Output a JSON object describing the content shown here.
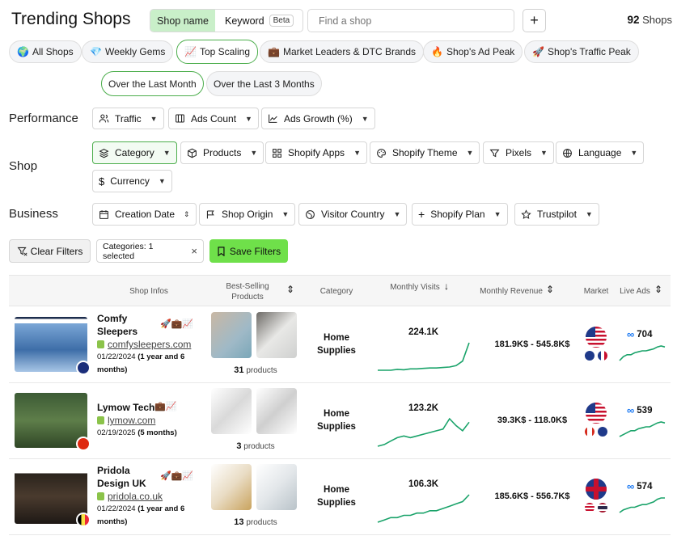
{
  "header": {
    "title": "Trending Shops",
    "tab_shop_name": "Shop name",
    "tab_keyword": "Keyword",
    "beta": "Beta",
    "search_placeholder": "Find a shop",
    "add": "+",
    "count_num": "92",
    "count_label": "Shops"
  },
  "quick_filters": [
    {
      "icon": "🌍",
      "label": "All Shops"
    },
    {
      "icon": "💎",
      "label": "Weekly Gems"
    },
    {
      "icon": "📈",
      "label": "Top Scaling"
    },
    {
      "icon": "💼",
      "label": "Market Leaders & DTC Brands"
    },
    {
      "icon": "🔥",
      "label": "Shop's Ad Peak"
    },
    {
      "icon": "🚀",
      "label": "Shop's Traffic Peak"
    }
  ],
  "periods": [
    "Over the Last Month",
    "Over the Last 3 Months"
  ],
  "sections": {
    "performance": "Performance",
    "shop": "Shop",
    "business": "Business"
  },
  "perf_filters": [
    "Traffic",
    "Ads Count",
    "Ads Growth (%)"
  ],
  "shop_filters": [
    "Category",
    "Products",
    "Shopify Apps",
    "Shopify Theme",
    "Pixels",
    "Language",
    "Currency"
  ],
  "business_filters": [
    "Creation Date",
    "Shop Origin",
    "Visitor Country",
    "Shopify Plan",
    "Trustpilot"
  ],
  "actions": {
    "clear": "Clear Filters",
    "tag": "Categories: 1 selected",
    "tag_close": "×",
    "save": "Save Filters"
  },
  "columns": {
    "shop_infos": "Shop Infos",
    "best_selling": "Best-Selling Products",
    "category": "Category",
    "visits": "Monthly Visits",
    "revenue": "Monthly Revenue",
    "market": "Market",
    "live_ads": "Live Ads"
  },
  "rows": [
    {
      "name1": "Comfy",
      "name2": "Sleepers",
      "url": "comfysleepers.com",
      "date": "01/22/2024",
      "age1": "(1 year and 6",
      "age2": "months)",
      "icons": "🚀💼📈",
      "products_num": "31",
      "products_label": "products",
      "cat1": "Home",
      "cat2": "Supplies",
      "visits": "224.1K",
      "revenue": "181.9K$ - 545.8K$",
      "ads": "704",
      "visits_trend": [
        3,
        3,
        3,
        3.2,
        3.1,
        3.3,
        3.3,
        3.4,
        3.5,
        3.5,
        3.6,
        3.7,
        4,
        5,
        9
      ],
      "ads_trend": [
        2,
        4,
        5,
        5,
        6,
        6.5,
        7,
        7,
        7.5,
        8,
        9,
        9.5,
        9
      ]
    },
    {
      "name1": "Lymow Tech",
      "name2": "",
      "url": "lymow.com",
      "date": "02/19/2025",
      "age1": "(5 months)",
      "age2": "",
      "icons": "💼📈",
      "products_num": "3",
      "products_label": "products",
      "cat1": "Home",
      "cat2": "Supplies",
      "visits": "123.2K",
      "revenue": "39.3K$ - 118.0K$",
      "ads": "539",
      "visits_trend": [
        2,
        2.5,
        3.5,
        4.5,
        5,
        4.5,
        5,
        5.5,
        6,
        6.5,
        7,
        10,
        8,
        6.5,
        9
      ],
      "ads_trend": [
        2,
        3,
        4,
        5,
        5,
        6,
        6.5,
        7,
        7,
        8,
        9,
        9.5,
        9
      ]
    },
    {
      "name1": "Pridola",
      "name2": "Design UK",
      "url": "pridola.co.uk",
      "date": "01/22/2024",
      "age1": "(1 year and 6",
      "age2": "months)",
      "icons": "🚀💼📈",
      "products_num": "13",
      "products_label": "products",
      "cat1": "Home",
      "cat2": "Supplies",
      "visits": "106.3K",
      "revenue": "185.6K$ - 556.7K$",
      "ads": "574",
      "visits_trend": [
        3,
        3.5,
        4,
        4,
        4.5,
        4.5,
        5,
        5,
        5.5,
        5.5,
        6,
        6.5,
        7,
        7.5,
        9
      ],
      "ads_trend": [
        3,
        4,
        4.5,
        5,
        5,
        5.5,
        6,
        6,
        6.5,
        7,
        8,
        8.5,
        8.5
      ]
    }
  ],
  "colors": {
    "accent_green": "#4cae4c",
    "save_green": "#6fe04a",
    "tab_green": "#c9efc9",
    "spark_green": "#1aa36a",
    "meta_blue": "#1877f2"
  }
}
